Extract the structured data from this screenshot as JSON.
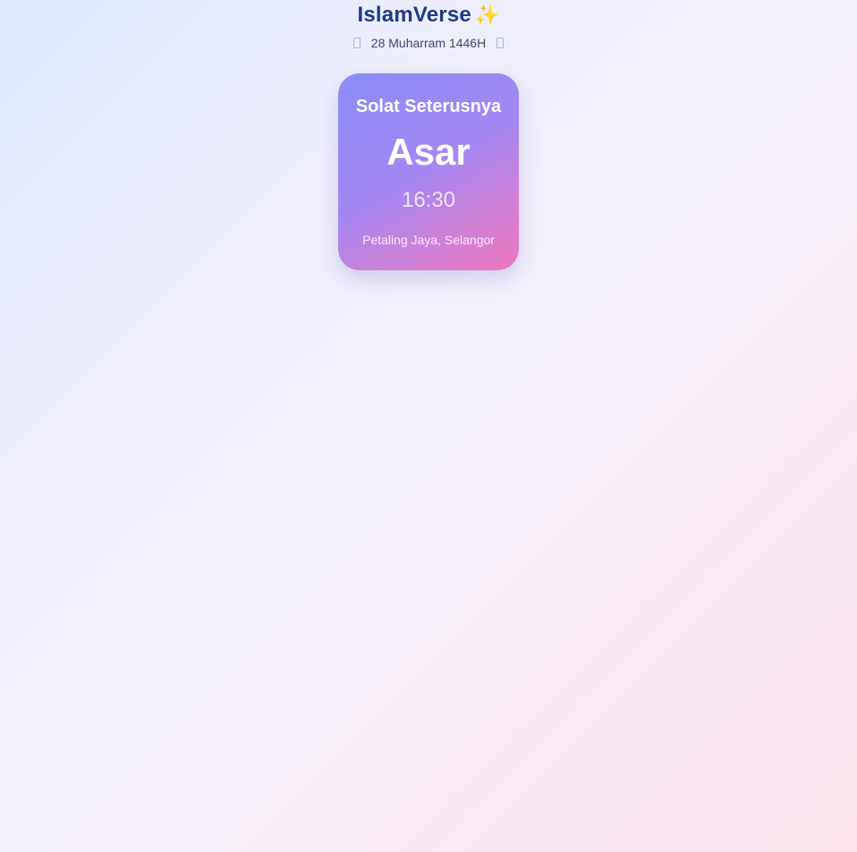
{
  "header": {
    "app_title": "IslamVerse",
    "title_emoji": "✨",
    "hijri_date": "28 Muharram 1446H"
  },
  "next_prayer": {
    "label": "Solat Seterusnya",
    "name": "Asar",
    "time": "16:30",
    "location": "Petaling Jaya, Selangor"
  },
  "colors": {
    "title": "#1e3a8a",
    "card_gradient_start": "#8b8cf6",
    "card_gradient_end": "#ef76bf"
  },
  "icons": {
    "left": "moon-icon",
    "right": "moon-icon",
    "title": "sparkles-icon"
  }
}
